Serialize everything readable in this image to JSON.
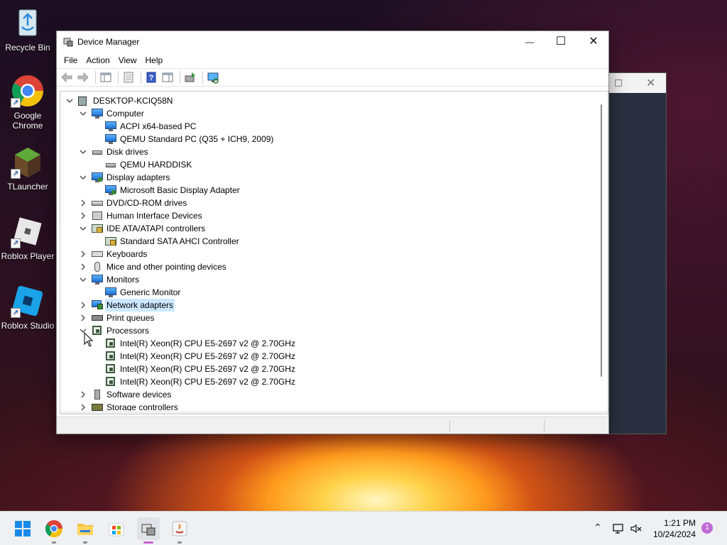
{
  "desktop": {
    "icons": [
      {
        "label": "Recycle Bin"
      },
      {
        "label": "Google Chrome"
      },
      {
        "label": "TLauncher"
      },
      {
        "label": "Roblox Player"
      },
      {
        "label": "Roblox Studio"
      }
    ]
  },
  "window": {
    "title": "Device Manager",
    "controls": {
      "minimize": "—",
      "maximize": "☐",
      "close": "✕"
    },
    "menu": [
      "File",
      "Action",
      "View",
      "Help"
    ],
    "background_window_close": "✕"
  },
  "tree": [
    {
      "label": "DESKTOP-KCIQ58N",
      "level": 0,
      "expander": "open",
      "icon": "computer-icon"
    },
    {
      "label": "Computer",
      "level": 1,
      "expander": "open",
      "icon": "monitor-icon"
    },
    {
      "label": "ACPI x64-based PC",
      "level": 2,
      "expander": "none",
      "icon": "monitor-icon"
    },
    {
      "label": "QEMU Standard PC (Q35 + ICH9, 2009)",
      "level": 2,
      "expander": "none",
      "icon": "monitor-icon"
    },
    {
      "label": "Disk drives",
      "level": 1,
      "expander": "open",
      "icon": "disk-icon"
    },
    {
      "label": "QEMU HARDDISK",
      "level": 2,
      "expander": "none",
      "icon": "disk-icon"
    },
    {
      "label": "Display adapters",
      "level": 1,
      "expander": "open",
      "icon": "display-adapter-icon"
    },
    {
      "label": "Microsoft Basic Display Adapter",
      "level": 2,
      "expander": "none",
      "icon": "display-adapter-icon"
    },
    {
      "label": "DVD/CD-ROM drives",
      "level": 1,
      "expander": "closed",
      "icon": "dvd-icon"
    },
    {
      "label": "Human Interface Devices",
      "level": 1,
      "expander": "closed",
      "icon": "hid-icon"
    },
    {
      "label": "IDE ATA/ATAPI controllers",
      "level": 1,
      "expander": "open",
      "icon": "ide-icon"
    },
    {
      "label": "Standard SATA AHCI Controller",
      "level": 2,
      "expander": "none",
      "icon": "ide-icon"
    },
    {
      "label": "Keyboards",
      "level": 1,
      "expander": "closed",
      "icon": "keyboard-icon"
    },
    {
      "label": "Mice and other pointing devices",
      "level": 1,
      "expander": "closed",
      "icon": "mouse-icon"
    },
    {
      "label": "Monitors",
      "level": 1,
      "expander": "open",
      "icon": "monitor-icon"
    },
    {
      "label": "Generic Monitor",
      "level": 2,
      "expander": "none",
      "icon": "monitor-icon"
    },
    {
      "label": "Network adapters",
      "level": 1,
      "expander": "closed",
      "icon": "network-icon",
      "selected": true
    },
    {
      "label": "Print queues",
      "level": 1,
      "expander": "closed",
      "icon": "printer-icon"
    },
    {
      "label": "Processors",
      "level": 1,
      "expander": "open",
      "icon": "processor-icon"
    },
    {
      "label": "Intel(R) Xeon(R) CPU E5-2697 v2 @ 2.70GHz",
      "level": 2,
      "expander": "none",
      "icon": "processor-icon"
    },
    {
      "label": "Intel(R) Xeon(R) CPU E5-2697 v2 @ 2.70GHz",
      "level": 2,
      "expander": "none",
      "icon": "processor-icon"
    },
    {
      "label": "Intel(R) Xeon(R) CPU E5-2697 v2 @ 2.70GHz",
      "level": 2,
      "expander": "none",
      "icon": "processor-icon"
    },
    {
      "label": "Intel(R) Xeon(R) CPU E5-2697 v2 @ 2.70GHz",
      "level": 2,
      "expander": "none",
      "icon": "processor-icon"
    },
    {
      "label": "Software devices",
      "level": 1,
      "expander": "closed",
      "icon": "software-icon"
    },
    {
      "label": "Storage controllers",
      "level": 1,
      "expander": "closed",
      "icon": "storage-icon"
    }
  ],
  "taskbar": {
    "time": "1:21 PM",
    "date": "10/24/2024",
    "notification_count": "1",
    "apps": [
      "start-icon",
      "chrome-icon",
      "file-explorer-icon",
      "store-icon",
      "device-manager-icon",
      "java-icon"
    ]
  },
  "colors": {
    "selection": "#cce8ff",
    "active_indicator": "#c75fd0"
  }
}
